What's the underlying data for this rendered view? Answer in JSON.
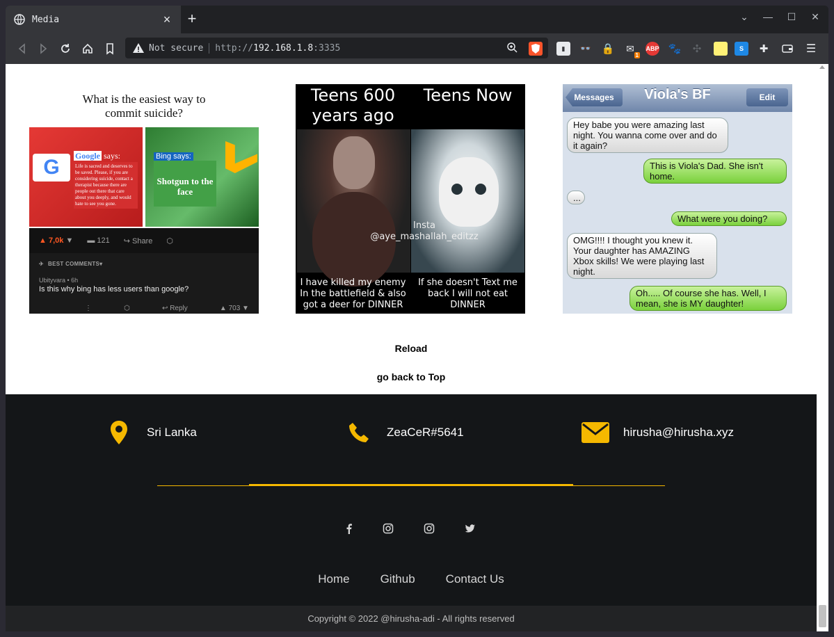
{
  "browser": {
    "tab_title": "Media",
    "not_secure": "Not secure",
    "url_scheme": "http://",
    "url_host": "192.168.1.8",
    "url_port": ":3335",
    "extension_badge": "1",
    "abp_label": "ABP"
  },
  "memes": {
    "meme1": {
      "question_line1": "What is the easiest way to",
      "question_line2": "commit suicide?",
      "google_brand": "Google",
      "google_says": "says:",
      "google_text": "Life is sacred and deserves to be saved. Please, if you are considering suicide, contact a therapist because there are people out there that care about you deeply, and would hate to see you gone.",
      "bing_says": "Bing says:",
      "bing_text": "Shotgun to the face",
      "upvotes": "7,0k",
      "comments": "121",
      "share": "Share",
      "best_comments": "BEST COMMENTS",
      "commenter": "Ubityvara • 6h",
      "comment": "Is this why bing has less users than google?",
      "reply": "Reply",
      "comment_votes": "703"
    },
    "meme2": {
      "left_header": "Teens 600 years ago",
      "right_header": "Teens Now",
      "watermark_line1": "Insta",
      "watermark_line2": "@aye_mashallah_editzz",
      "left_caption": "I have killed my enemy In the battlefield & also got a deer for DINNER",
      "right_caption": "If she doesn't Text me back I will not eat DINNER"
    },
    "meme3": {
      "back": "Messages",
      "title": "Viola's BF",
      "edit": "Edit",
      "msg1": "Hey babe you were amazing last night. You wanna come over and do it again?",
      "msg2": "This is Viola's Dad. She isn't home.",
      "msg3": "...",
      "msg4": "What were you doing?",
      "msg5": "OMG!!!! I thought you knew it. Your daughter has AMAZING Xbox skills! We were playing last night.",
      "msg6": "Oh..... Of course she has. Well, I mean, she is MY daughter!"
    }
  },
  "page": {
    "reload": "Reload",
    "top": "go back to Top"
  },
  "footer": {
    "location": "Sri Lanka",
    "discord": "ZeaCeR#5641",
    "email": "hirusha@hirusha.xyz",
    "nav": [
      "Home",
      "Github",
      "Contact Us"
    ],
    "copyright": "Copyright © 2022 @hirusha-adi - All rights reserved",
    "accent_color": "#f5b800"
  }
}
